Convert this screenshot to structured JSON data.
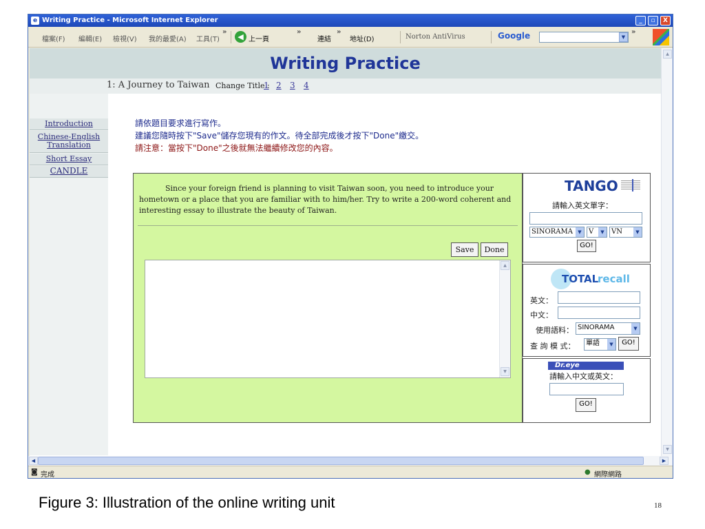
{
  "window": {
    "title": "Writing Practice - Microsoft Internet Explorer",
    "min": "_",
    "max": "▫",
    "close": "X"
  },
  "toolbar": {
    "menus": [
      "檔案(F)",
      "編輯(E)",
      "檢視(V)",
      "我的最愛(A)",
      "工具(T)"
    ],
    "more1": "»",
    "back": "上一頁",
    "more2": "»",
    "links": "連結",
    "more3": "»",
    "address": "地址(D)",
    "norton": "Norton AntiVirus",
    "google": "Google",
    "more4": "»"
  },
  "page": {
    "title": "Writing Practice",
    "journey": "1: A Journey to Taiwan",
    "change_title": "Change Title :",
    "title_links": [
      "1",
      "2",
      "3",
      "4"
    ],
    "nav": [
      "Introduction",
      "Chinese-English Translation",
      "Short Essay",
      "CANDLE"
    ],
    "instructions": [
      "請依題目要求進行寫作。",
      "建議您隨時按下\"Save\"儲存您現有的作文。待全部完成後才按下\"Done\"繳交。",
      "請注意：當按下\"Done\"之後就無法繼續修改您的內容。"
    ],
    "instruction_colors": [
      "#1c2a8c",
      "#1c2a8c",
      "#8c1414"
    ],
    "prompt": "Since your foreign friend is planning to visit Taiwan soon, you need to introduce your hometown or a place that you are familiar with to him/her. Try to write a 200-word coherent and interesting essay to illustrate the beauty of Taiwan.",
    "save": "Save",
    "done": "Done"
  },
  "side": {
    "tango": {
      "logo": "TANGO",
      "prompt": "請輸入英文單字：",
      "source": "SINORAMA",
      "pos": "V",
      "lang": "VN",
      "go": "GO!"
    },
    "total": {
      "logo_a": "TOTAL",
      "logo_b": "recall",
      "en": "英文：",
      "zh": "中文：",
      "corpus_label": "使用語料：",
      "corpus": "SINORAMA",
      "mode_label": "查 詢 模 式：",
      "mode": "單語",
      "go": "GO!"
    },
    "dreye": {
      "logo": "Dr.eye",
      "prompt": "請輸入中文或英文：",
      "go": "GO!"
    }
  },
  "status": {
    "left": "完成",
    "right": "網際網路"
  },
  "caption": "Figure 3: Illustration of the online writing unit",
  "page_number": "18"
}
